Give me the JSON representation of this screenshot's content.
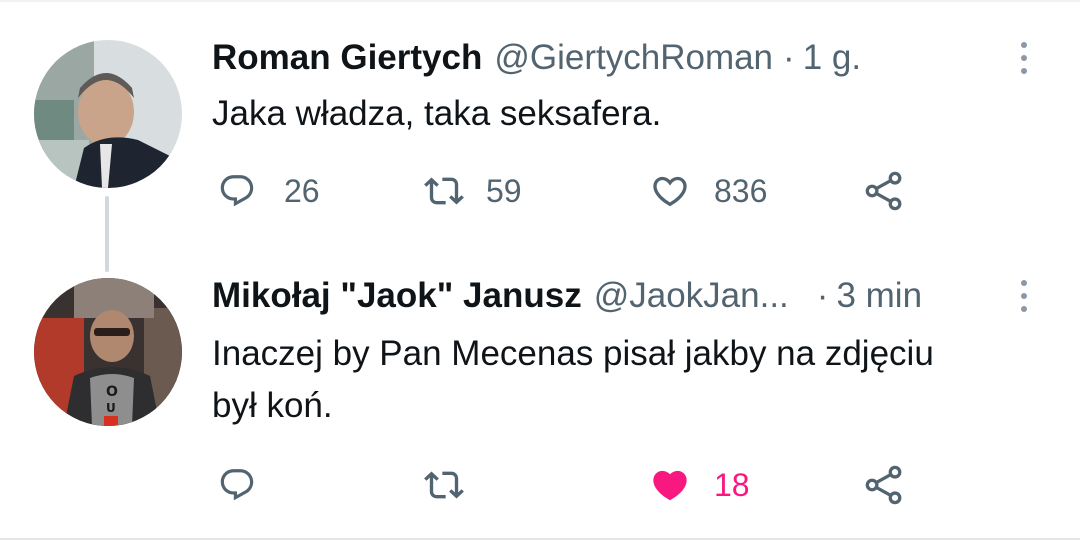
{
  "tweets": [
    {
      "author_name": "Roman Giertych",
      "handle": "@GiertychRoman",
      "separator": "·",
      "time": "1 g.",
      "text": "Jaka władza, taka seksafera.",
      "replies": "26",
      "retweets": "59",
      "likes": "836",
      "liked": false
    },
    {
      "author_name": "Mikołaj \"Jaok\" Janusz",
      "handle": "@JaokJan...",
      "separator": "·",
      "time": "3 min",
      "text_line1": "Inaczej by Pan Mecenas pisał jakby na zdjęciu",
      "text_line2": "był koń.",
      "replies": "",
      "retweets": "",
      "likes": "18",
      "liked": true
    }
  ],
  "icons": {
    "reply": "reply-icon",
    "retweet": "retweet-icon",
    "like": "heart-icon",
    "share": "share-icon",
    "more": "more-options-icon"
  },
  "colors": {
    "text": "#0f1419",
    "secondary": "#536471",
    "like_active": "#f91880",
    "thread_line": "#cfd9de"
  }
}
